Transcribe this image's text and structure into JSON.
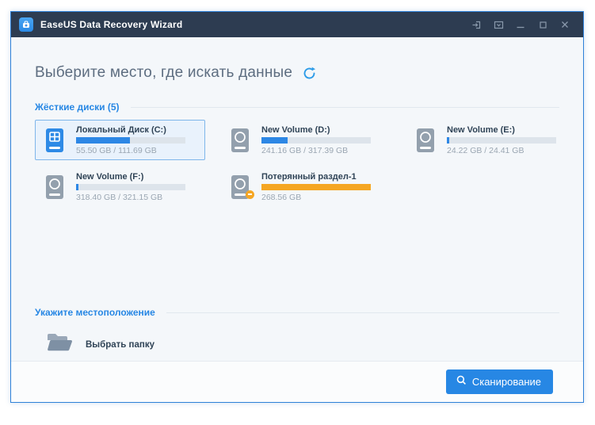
{
  "window": {
    "title": "EaseUS Data Recovery Wizard",
    "controls": [
      "sign-in",
      "menu",
      "minimize",
      "maximize",
      "close"
    ]
  },
  "header": {
    "title": "Выберите место, где искать данные"
  },
  "sections": {
    "drives_label": "Жёсткие диски (5)",
    "location_label": "Укажите местоположение"
  },
  "drives": [
    {
      "name": "Локальный Диск (C:)",
      "size": "55.50 GB / 111.69 GB",
      "percent": 49,
      "selected": true,
      "lost": false
    },
    {
      "name": "New Volume (D:)",
      "size": "241.16 GB / 317.39 GB",
      "percent": 24,
      "selected": false,
      "lost": false
    },
    {
      "name": "New Volume (E:)",
      "size": "24.22 GB / 24.41 GB",
      "percent": 2,
      "selected": false,
      "lost": false
    },
    {
      "name": "New Volume (F:)",
      "size": "318.40 GB / 321.15 GB",
      "percent": 2,
      "selected": false,
      "lost": false
    },
    {
      "name": "Потерянный раздел-1",
      "size": "268.56 GB",
      "percent": 100,
      "selected": false,
      "lost": true
    }
  ],
  "folder_picker": {
    "label": "Выбрать папку"
  },
  "footer": {
    "scan_label": "Сканирование"
  },
  "colors": {
    "accent": "#2787e4",
    "orange": "#f5a623",
    "bar_blue": "#2d87e5",
    "titlebar_bg": "#2d3c51",
    "window_border": "#2f81d8",
    "content_bg": "#f4f7fa"
  }
}
